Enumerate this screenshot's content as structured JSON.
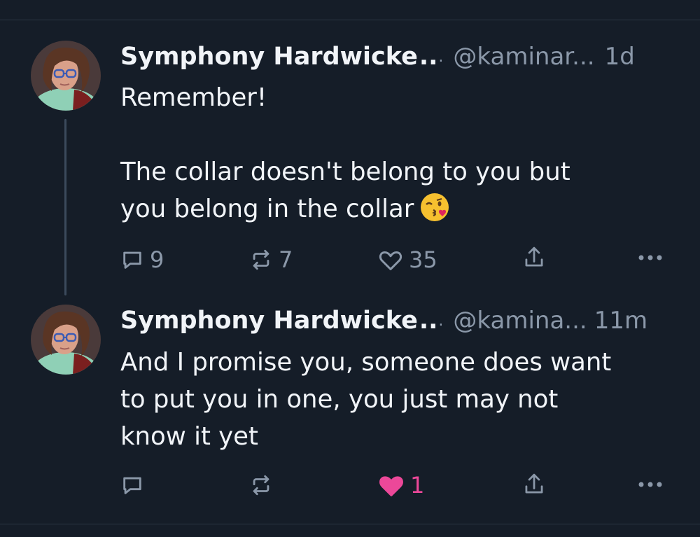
{
  "posts": [
    {
      "display_name": "Symphony Hardwicke",
      "name_ellipsis": "..",
      "name_ellipsis_small": ".",
      "handle": "@kaminar...",
      "time": "1d",
      "text": "Remember!\n\nThe collar doesn't belong to you but\nyou belong in the collar",
      "emoji": "kissing-wink-face-emoji",
      "actions": {
        "replies": "9",
        "reposts": "7",
        "likes": "35",
        "liked": false
      }
    },
    {
      "display_name": "Symphony Hardwicke",
      "name_ellipsis": "..",
      "name_ellipsis_small": ".",
      "handle": "@kamina...",
      "time": "11m",
      "text": "And I promise you, someone does want\nto put you in one, you just may not\nknow it yet",
      "actions": {
        "replies": "",
        "reposts": "",
        "likes": "1",
        "liked": true
      }
    }
  ],
  "colors": {
    "background": "#151d28",
    "text": "#f1f4f8",
    "muted": "#8b98a9",
    "like_active": "#ec4899",
    "thread_line": "#3b4a5c"
  }
}
